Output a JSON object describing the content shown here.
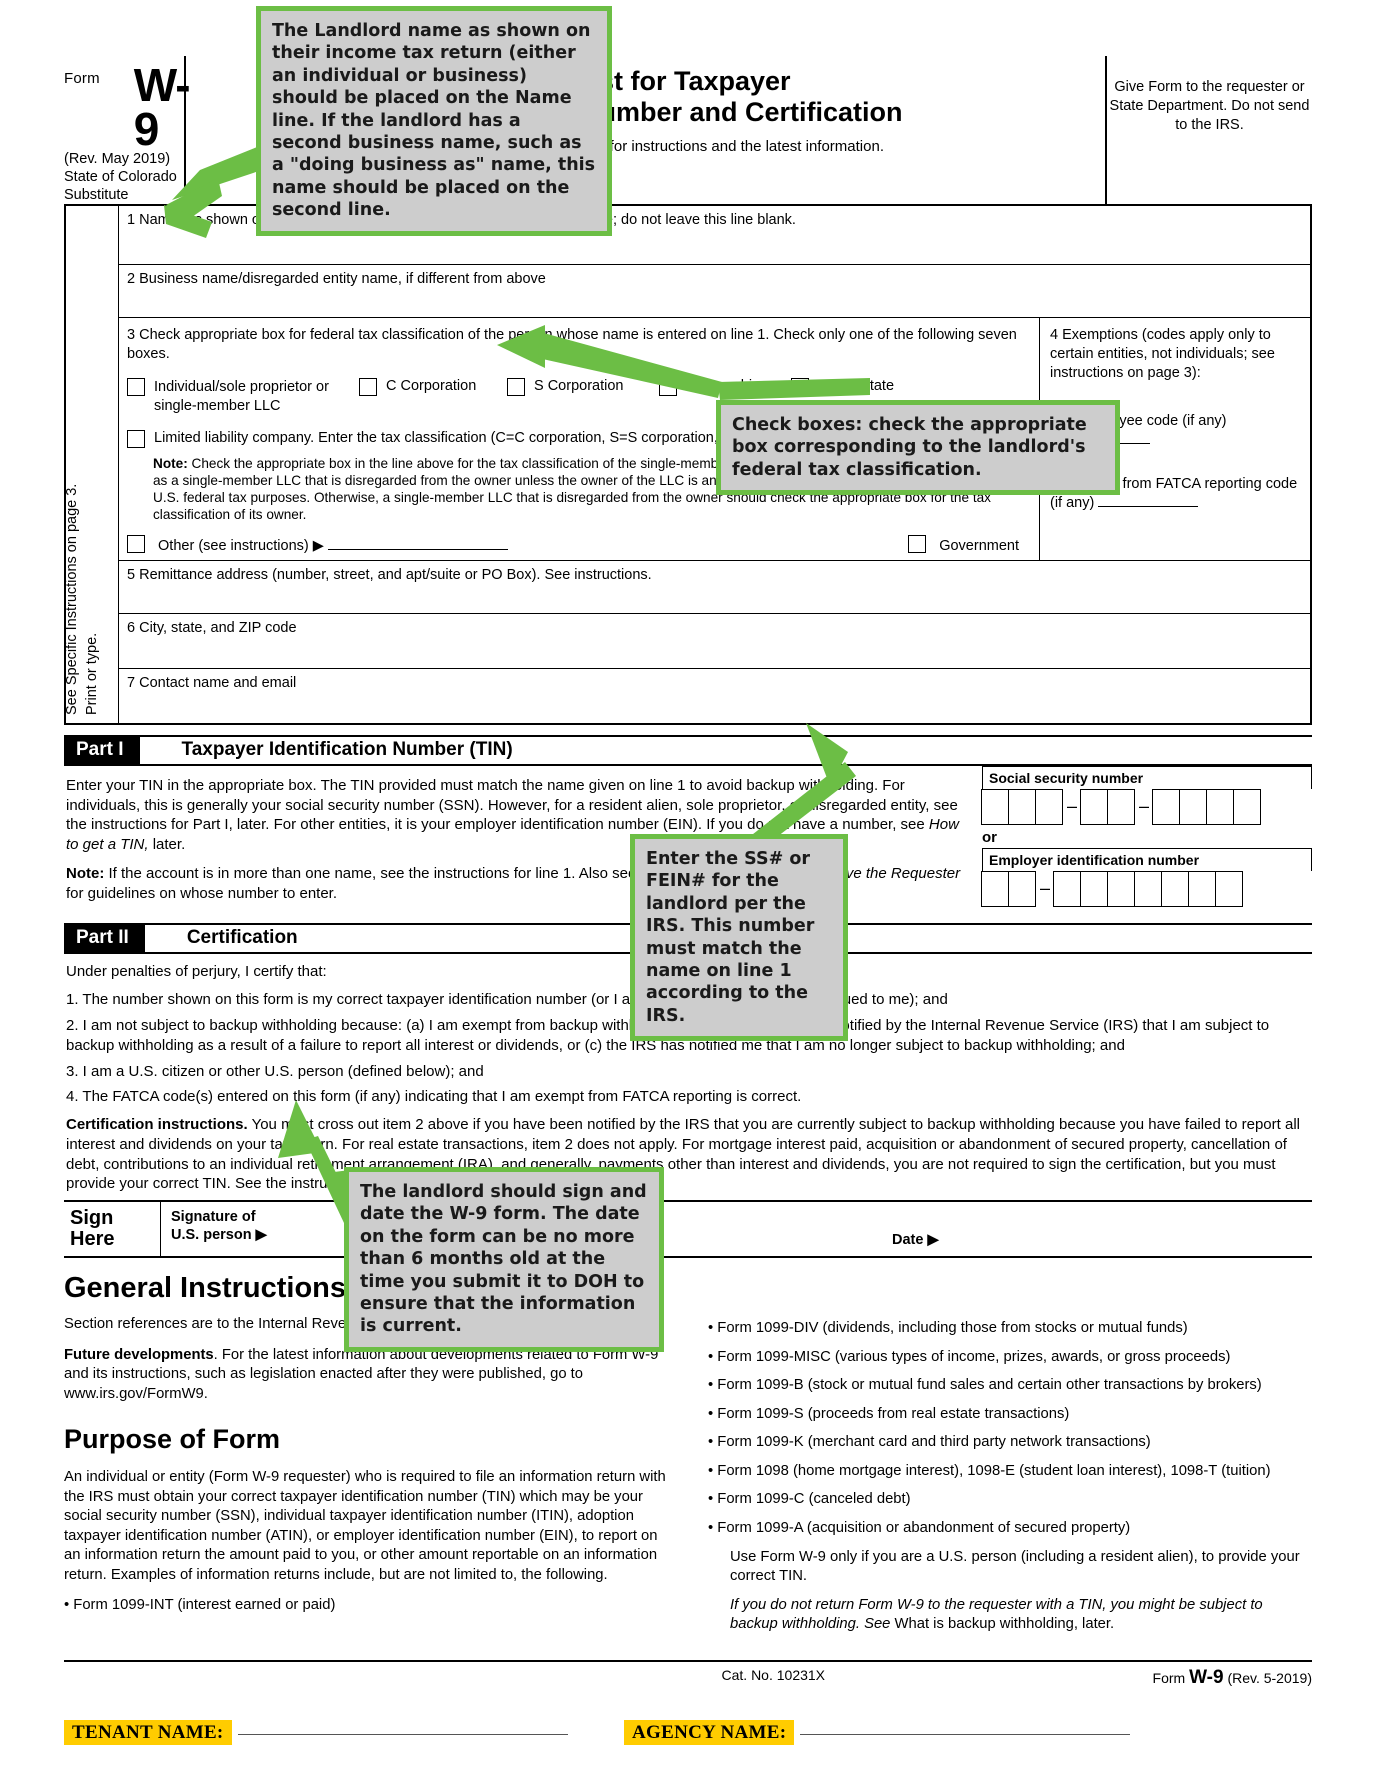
{
  "form": {
    "form_word": "Form",
    "number": "W-9",
    "rev_lines": [
      "(Rev. May 2019)",
      "State of Colorado",
      "Substitute"
    ],
    "title_line1": "Request for Taxpayer",
    "title_line2": "Identification Number and Certification",
    "subtitle": "Go to www.irs.gov/FormW9 for instructions and the latest information.",
    "give_to": "Give Form to the requester or State Department. Do not send to the IRS.",
    "line1": "1  Name (as shown on your income tax return). Name is required on this line; do not leave this line blank.",
    "line2": "2  Business name/disregarded entity name, if different from above",
    "line3_text": "3  Check appropriate box for federal tax classification of the person whose name is entered on line 1. Check only one of the following seven boxes.",
    "classifications": [
      "Individual/sole proprietor or single-member LLC",
      "C Corporation",
      "S Corporation",
      "Partnership",
      "Trust/estate"
    ],
    "llc_line": "Limited liability company. Enter the tax classification (C=C corporation, S=S corporation, P=Partnership) ▶",
    "llc_note_bold": "Note:",
    "llc_note": " Check the appropriate box in the line above for the tax classification of the single-member owner.  Do not check LLC if the LLC is classified as a single-member LLC that is disregarded from the owner unless the owner of the LLC is another LLC that is not disregarded from the owner for U.S. federal tax purposes. Otherwise, a single-member LLC that is disregarded from the owner should check the appropriate box for the tax classification of its owner.",
    "other_label": "Other (see instructions) ▶",
    "government_label": "Government",
    "exemptions_head": "4  Exemptions (codes apply only to certain entities, not individuals; see instructions on page 3):",
    "exempt_payee": "Exempt payee code (if any)",
    "exempt_fatca": "Exemption from FATCA reporting code (if any)",
    "line5": "5  Remittance address (number, street, and apt/suite or PO Box). See instructions.",
    "line6": "6  City, state, and ZIP code",
    "line7": "7  Contact name and email",
    "side_label_a": "Print or type.",
    "side_label_b": "See Specific Instructions on page 3."
  },
  "part1": {
    "label": "Part I",
    "title": "Taxpayer Identification Number (TIN)",
    "body1": "Enter your TIN in the appropriate box. The TIN provided must match the name given on line 1 to avoid backup withholding. For individuals, this is generally your social security number (SSN). However, for a resident alien, sole proprietor, or disregarded entity, see the instructions for Part I, later. For other entities, it is your employer identification number (EIN). If you do not have a number, see ",
    "body1_italic": "How to get a TIN,",
    "body1_end": " later.",
    "note_bold": "Note:",
    "note": " If the account is in more than one name, see the instructions for line 1. Also see ",
    "note_italic": "What Name and Number To Give the Requester",
    "note_end": " for guidelines on whose number to enter.",
    "ssn_label": "Social security number",
    "ein_label": "Employer identification number",
    "or_label": "or"
  },
  "part2": {
    "label": "Part II",
    "title": "Certification",
    "intro": "Under penalties of perjury, I certify that:",
    "items": [
      "1. The number shown on this form is my correct taxpayer identification number (or I am waiting for a number to be issued to me); and",
      "2. I am not subject to backup withholding because: (a) I am exempt from backup withholding, or (b) I have not been notified by the Internal Revenue Service (IRS) that I am subject to backup withholding as a result of a failure to report all interest or dividends, or (c) the IRS has notified me that I am no longer subject to backup withholding; and",
      "3. I am a U.S. citizen or other U.S. person (defined below); and",
      "4. The FATCA code(s) entered on this form (if any) indicating that I am exempt from FATCA reporting is correct."
    ],
    "cert_bold": "Certification instructions.",
    "cert_text": " You must cross out item 2 above if you have been notified by the IRS that you are currently subject to backup withholding because you have failed to report all interest and dividends on your tax return. For real estate transactions, item 2 does not apply. For mortgage interest paid, acquisition or abandonment of secured property, cancellation of debt, contributions to an individual retirement arrangement (IRA), and generally, payments other than interest and dividends, you are not required to sign the certification, but you must provide your correct TIN. See the instructions for Part II, later."
  },
  "sign": {
    "here_line1": "Sign",
    "here_line2": "Here",
    "sig_line1": "Signature of",
    "sig_line2": "U.S. person ▶",
    "date_label": "Date ▶"
  },
  "general": {
    "title": "General Instructions",
    "p1": "Section references are to the Internal Revenue Code unless otherwise noted.",
    "p2_bold": "Future developments",
    "p2": ". For the latest information about developments related to Form W-9 and its instructions, such as legislation enacted after they were published, go to www.irs.gov/FormW9.",
    "purpose_title": "Purpose of Form",
    "purpose_p1": "An individual or entity (Form W-9 requester) who is required to file an information return with the IRS must obtain your correct taxpayer identification number (TIN) which may be your social security number (SSN), individual taxpayer identification number (ITIN), adoption taxpayer identification number (ATIN), or employer identification number (EIN), to report on an information return the amount paid to you, or other amount reportable on an information return. Examples of information returns include, but are not limited to, the following.",
    "left_bullet": "• Form 1099-INT (interest earned or paid)",
    "right_bullets": [
      "• Form 1099-DIV (dividends, including those from stocks or mutual funds)",
      "• Form 1099-MISC (various types of income, prizes, awards, or gross proceeds)",
      "• Form 1099-B (stock or mutual fund sales and certain other transactions by brokers)",
      "• Form 1099-S (proceeds from real estate transactions)",
      "• Form 1099-K (merchant card and third party network transactions)",
      "• Form 1098 (home mortgage interest), 1098-E (student loan interest), 1098-T (tuition)",
      "• Form 1099-C (canceled debt)",
      "• Form 1099-A (acquisition or abandonment of secured property)"
    ],
    "use_note": "Use Form W-9 only if you are a U.S. person (including a resident alien), to provide your correct TIN.",
    "italic_note": "If you do not return Form W-9 to the requester with a TIN, you might be subject to backup withholding. See",
    "italic_note2": " What is backup withholding, later."
  },
  "footer": {
    "cat": "Cat. No. 10231X",
    "form_word": "Form",
    "form_num": "W-9",
    "form_rev": "(Rev. 5-2019)"
  },
  "bottom": {
    "tenant_label": "TENANT NAME:",
    "agency_label": "AGENCY NAME:"
  },
  "callouts": [
    {
      "id": "name-line-callout",
      "text": "The Landlord name as shown on their income tax return (either an individual or business) should be placed on the Name line. If the landlord has a second business name, such as a \"doing business as\" name, this name should be placed on the second line."
    },
    {
      "id": "check-boxes-callout",
      "text": "Check boxes: check the appropriate box corresponding to the landlord's federal tax classification."
    },
    {
      "id": "tin-callout",
      "text": "Enter the SS# or FEIN# for the landlord per the IRS. This  number must match the name on line 1 according to the IRS."
    },
    {
      "id": "signature-callout",
      "text": "The landlord should sign and date the W-9 form. The date on the form can be no more than 6 months old at the time you submit it to DOH to ensure that the information is current."
    }
  ],
  "colors": {
    "callout_border": "#6cbe45",
    "callout_bg": "#cdcdcd",
    "highlight": "#FFCC00"
  }
}
